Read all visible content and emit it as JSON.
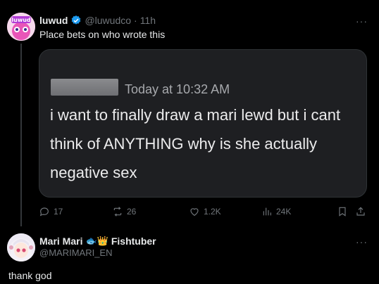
{
  "post": {
    "author_name": "luwud",
    "handle": "@luwudco",
    "separator": "·",
    "time": "11h",
    "text": "Place bets on who wrote this",
    "more_label": "···",
    "avatar_text": "luwud",
    "media": {
      "timestamp": "Today at 10:32 AM",
      "message": "i want to finally draw a mari lewd but i cant think of ANYTHING why is she actually negative sex"
    },
    "actions": {
      "replies": "17",
      "reposts": "26",
      "likes": "1.2K",
      "views": "24K"
    }
  },
  "reply": {
    "author_name": "Mari Mari",
    "name_emojis": "🐟👑",
    "name_suffix": "Fishtuber",
    "handle": "@MARIMARI_EN",
    "text": "thank god",
    "more_label": "···"
  },
  "colors": {
    "background": "#000000",
    "text_primary": "#e7e9ea",
    "text_secondary": "#71767b",
    "verified_blue": "#1d9bf0",
    "card_background": "#1e1f22"
  },
  "icons": [
    "verified-icon",
    "reply-icon",
    "repost-icon",
    "like-icon",
    "views-icon",
    "bookmark-icon",
    "share-icon",
    "more-icon"
  ]
}
